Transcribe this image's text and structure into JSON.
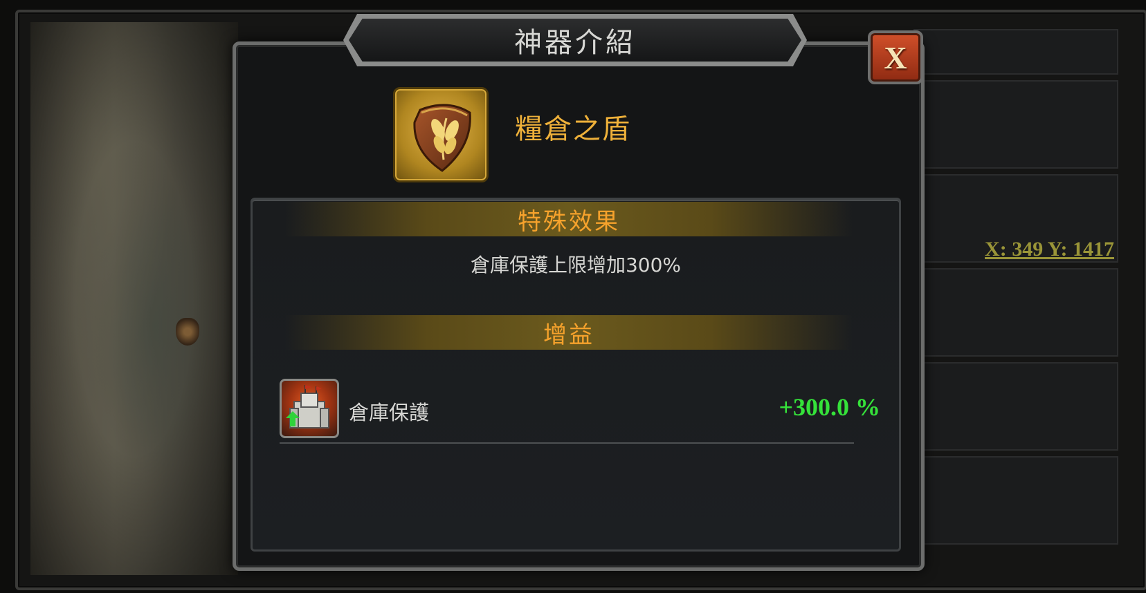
{
  "background": {
    "coordinates_text": "X: 349 Y: 1417"
  },
  "dialog": {
    "title": "神器介紹",
    "close_label": "X",
    "artifact": {
      "name": "糧倉之盾",
      "icon": "wheat-shield-icon"
    },
    "special_effect": {
      "header": "特殊效果",
      "text": "倉庫保護上限增加300%"
    },
    "buffs": {
      "header": "增益",
      "items": [
        {
          "icon": "warehouse-protection-icon",
          "label": "倉庫保護",
          "value": "+300.0 %"
        }
      ]
    }
  },
  "colors": {
    "accent_gold": "#efb13a",
    "header_orange": "#f6a22c",
    "positive_green": "#35e23a",
    "coords_olive": "#9a9538",
    "close_red": "#c2441f"
  }
}
